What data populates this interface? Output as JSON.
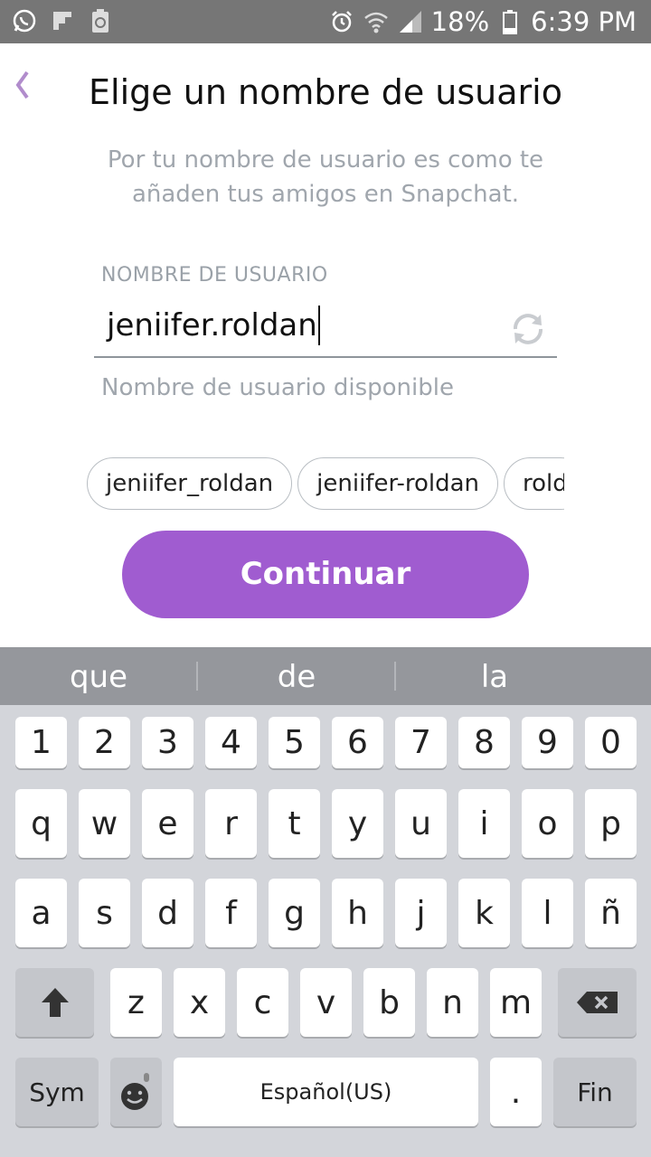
{
  "status_bar": {
    "battery": "18%",
    "time": "6:39 PM"
  },
  "header": {
    "title": "Elige un nombre de usuario",
    "subtitle": "Por tu nombre de usuario es como te añaden tus amigos en Snapchat."
  },
  "form": {
    "label": "NOMBRE DE USUARIO",
    "value": "jeniifer.roldan",
    "helper": "Nombre de usuario disponible"
  },
  "suggestions": [
    "jeniifer_roldan",
    "jeniifer-roldan",
    "rold"
  ],
  "continue_label": "Continuar",
  "keyboard": {
    "predictions": [
      "que",
      "de",
      "la"
    ],
    "row_numbers": [
      "1",
      "2",
      "3",
      "4",
      "5",
      "6",
      "7",
      "8",
      "9",
      "0"
    ],
    "row1": [
      "q",
      "w",
      "e",
      "r",
      "t",
      "y",
      "u",
      "i",
      "o",
      "p"
    ],
    "row2": [
      "a",
      "s",
      "d",
      "f",
      "g",
      "h",
      "j",
      "k",
      "l",
      "ñ"
    ],
    "row3": [
      "z",
      "x",
      "c",
      "v",
      "b",
      "n",
      "m"
    ],
    "sym_label": "Sym",
    "space_label": "Español(US)",
    "period": ".",
    "enter_label": "Fin"
  },
  "colors": {
    "accent": "#a05cd0",
    "status_bar": "#767676",
    "keyboard_bg": "#d3d5da"
  }
}
